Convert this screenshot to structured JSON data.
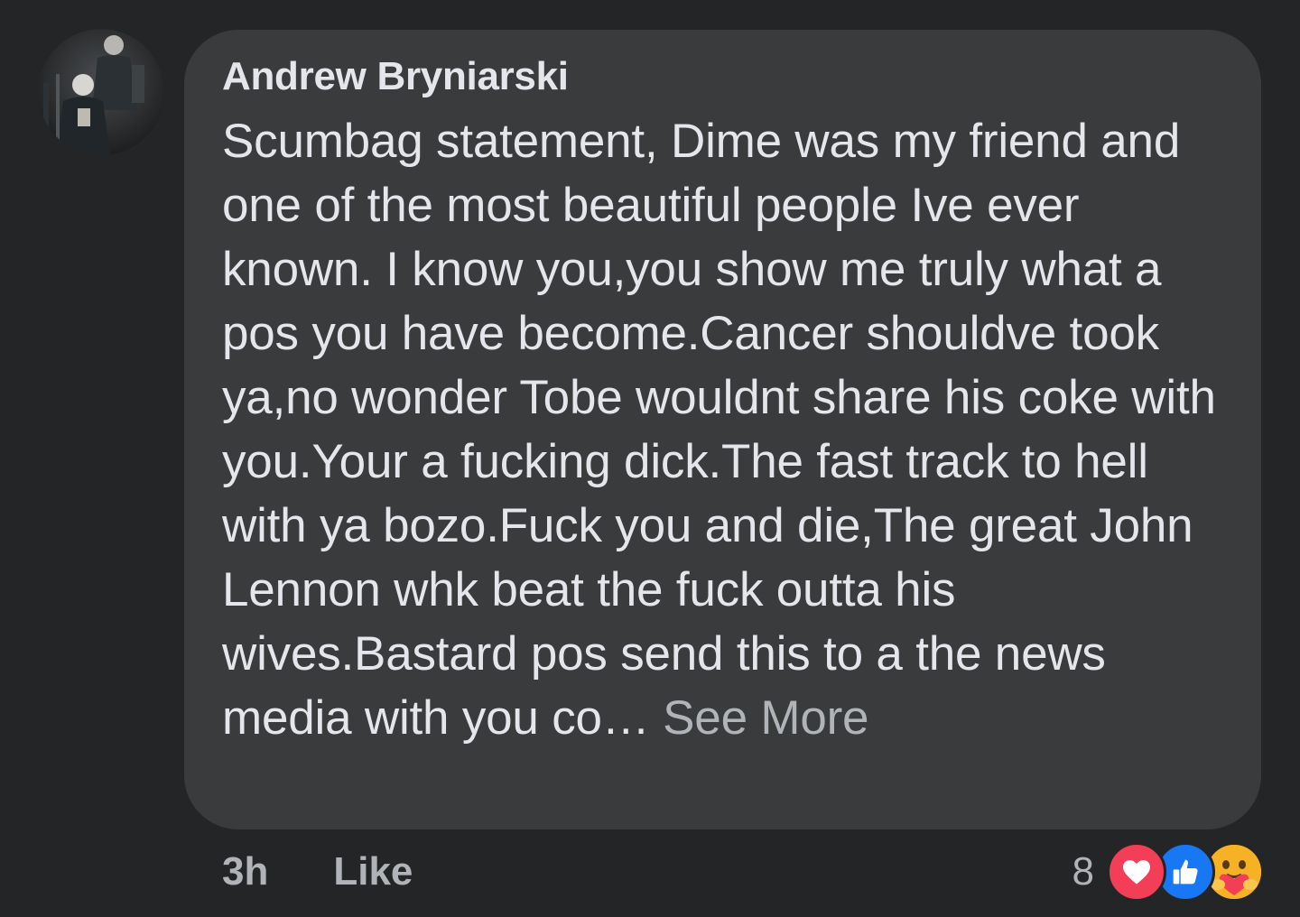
{
  "comment": {
    "author": "Andrew Bryniarski",
    "text": "Scumbag statement, Dime was my friend and one of the most beautiful people Ive ever known. I know you,you show me truly what a pos you have become.Cancer shouldve took ya,no wonder Tobe wouldnt share his coke with you.Your a fucking dick.The fast track to hell with ya bozo.Fuck you and die,The great John Lennon whk beat the fuck outta his wives.Bastard pos send this to a the news media with you co… ",
    "see_more": "See More"
  },
  "actions": {
    "time": "3h",
    "like": "Like"
  },
  "reactions": {
    "count": "8",
    "icons": [
      "love-icon",
      "like-icon",
      "care-icon"
    ]
  },
  "colors": {
    "background": "#242526",
    "bubble": "#3a3b3c",
    "text": "#e4e6eb",
    "secondary_text": "#b0b3b8",
    "love": "#f33e58",
    "like": "#1877f2",
    "care": "#f7b125"
  }
}
